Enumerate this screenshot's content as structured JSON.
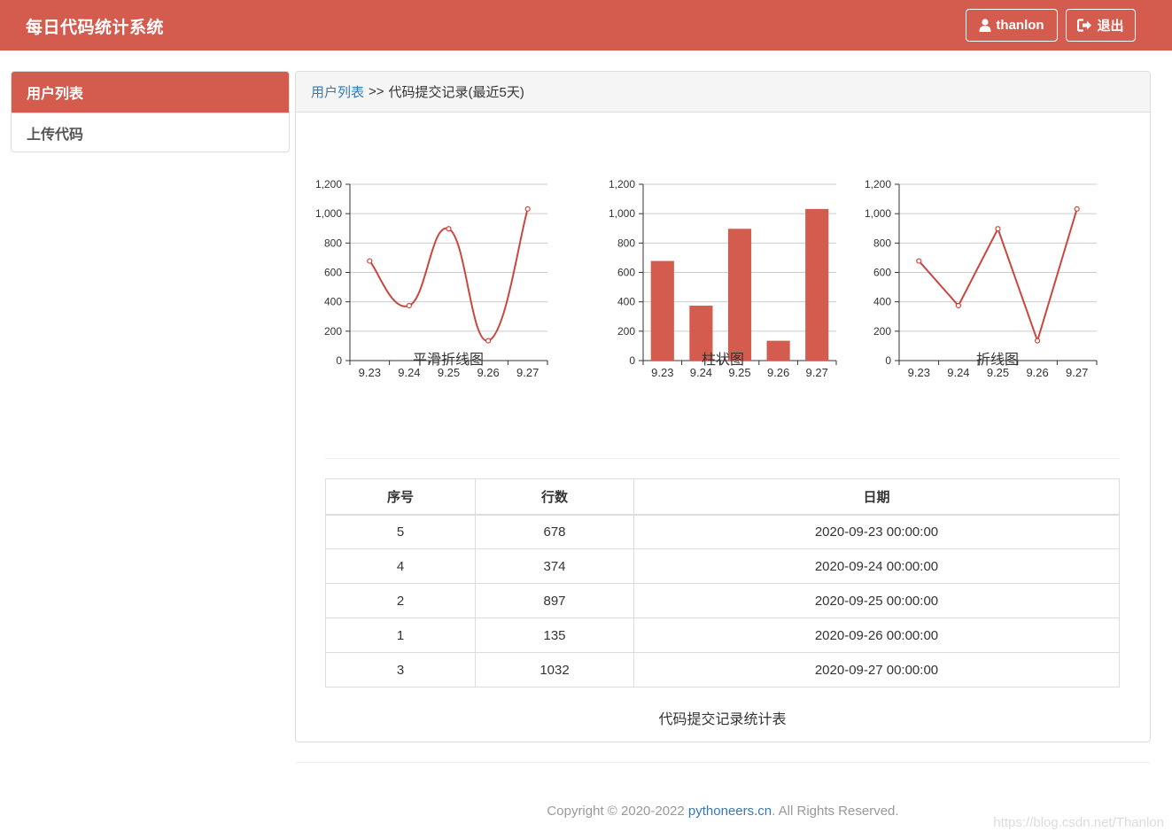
{
  "navbar": {
    "brand": "每日代码统计系统",
    "user_label": "thanlon",
    "logout_label": "退出"
  },
  "sidebar": {
    "items": [
      {
        "label": "用户列表",
        "active": true
      },
      {
        "label": "上传代码",
        "active": false
      }
    ]
  },
  "breadcrumb": {
    "link": "用户列表",
    "separator": ">>",
    "current": "代码提交记录(最近5天)"
  },
  "colors": {
    "brand": "#d35c4f",
    "series": "#c9473f",
    "bar": "#d35c4f",
    "link": "#337ab7"
  },
  "chart_data": [
    {
      "type": "line",
      "smooth": true,
      "title": "平滑折线图",
      "x": [
        "9.23",
        "9.24",
        "9.25",
        "9.26",
        "9.27"
      ],
      "y": [
        678,
        374,
        897,
        135,
        1032
      ],
      "ylim": [
        0,
        1200
      ],
      "yticks": [
        "0",
        "200",
        "400",
        "600",
        "800",
        "1,000",
        "1,200"
      ],
      "grid": true
    },
    {
      "type": "bar",
      "title": "柱状图",
      "categories": [
        "9.23",
        "9.24",
        "9.25",
        "9.26",
        "9.27"
      ],
      "values": [
        678,
        374,
        897,
        135,
        1032
      ],
      "ylim": [
        0,
        1200
      ],
      "yticks": [
        "0",
        "200",
        "400",
        "600",
        "800",
        "1,000",
        "1,200"
      ],
      "grid": true
    },
    {
      "type": "line",
      "smooth": false,
      "title": "折线图",
      "x": [
        "9.23",
        "9.24",
        "9.25",
        "9.26",
        "9.27"
      ],
      "y": [
        678,
        374,
        897,
        135,
        1032
      ],
      "ylim": [
        0,
        1200
      ],
      "yticks": [
        "0",
        "200",
        "400",
        "600",
        "800",
        "1,000",
        "1,200"
      ],
      "grid": true
    }
  ],
  "table": {
    "headers": [
      "序号",
      "行数",
      "日期"
    ],
    "rows": [
      [
        "5",
        "678",
        "2020-09-23 00:00:00"
      ],
      [
        "4",
        "374",
        "2020-09-24 00:00:00"
      ],
      [
        "2",
        "897",
        "2020-09-25 00:00:00"
      ],
      [
        "1",
        "135",
        "2020-09-26 00:00:00"
      ],
      [
        "3",
        "1032",
        "2020-09-27 00:00:00"
      ]
    ],
    "caption": "代码提交记录统计表"
  },
  "footer": {
    "prefix": "Copyright © 2020-2022",
    "link": "pythoneers.cn",
    "suffix": ". All Rights Reserved."
  },
  "watermark": "https://blog.csdn.net/Thanlon"
}
